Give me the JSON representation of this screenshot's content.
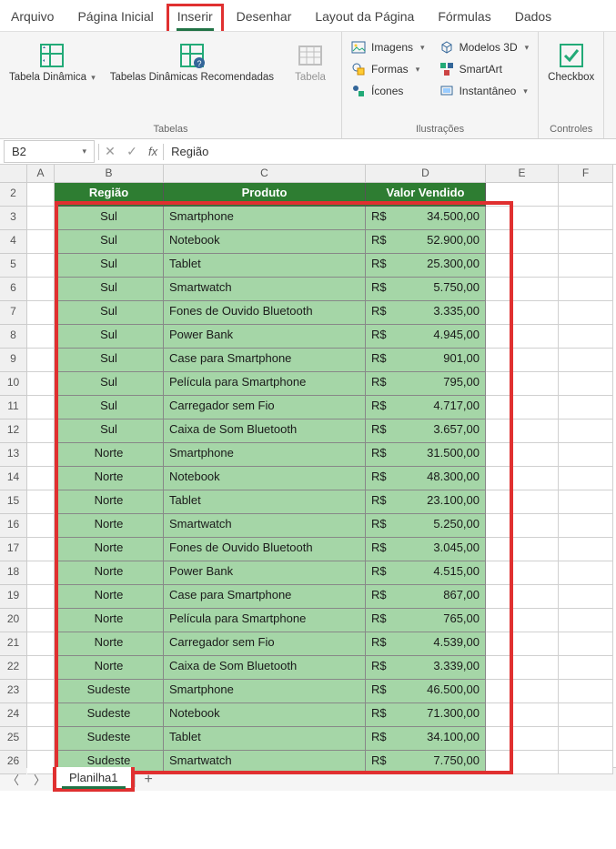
{
  "menubar": {
    "items": [
      "Arquivo",
      "Página Inicial",
      "Inserir",
      "Desenhar",
      "Layout da Página",
      "Fórmulas",
      "Dados"
    ],
    "activeIndex": 2
  },
  "ribbon": {
    "groups": {
      "tabelas": {
        "label": "Tabelas",
        "pivotTable": "Tabela\nDinâmica",
        "recommendedPivot": "Tabelas Dinâmicas\nRecomendadas",
        "table": "Tabela"
      },
      "ilustracoes": {
        "label": "Ilustrações",
        "images": "Imagens",
        "shapes": "Formas",
        "icons": "Ícones",
        "models3d": "Modelos 3D",
        "smartart": "SmartArt",
        "screenshot": "Instantâneo"
      },
      "controles": {
        "label": "Controles",
        "checkbox": "Checkbox"
      }
    }
  },
  "formulaBar": {
    "nameBox": "B2",
    "formula": "Região"
  },
  "columns": [
    "A",
    "B",
    "C",
    "D",
    "E",
    "F"
  ],
  "rowStart": 2,
  "rowCount": 25,
  "tableHeaders": {
    "regiao": "Região",
    "produto": "Produto",
    "valor": "Valor Vendido"
  },
  "tableData": [
    {
      "regiao": "Sul",
      "produto": "Smartphone",
      "cur": "R$",
      "valor": "34.500,00"
    },
    {
      "regiao": "Sul",
      "produto": "Notebook",
      "cur": "R$",
      "valor": "52.900,00"
    },
    {
      "regiao": "Sul",
      "produto": "Tablet",
      "cur": "R$",
      "valor": "25.300,00"
    },
    {
      "regiao": "Sul",
      "produto": "Smartwatch",
      "cur": "R$",
      "valor": "5.750,00"
    },
    {
      "regiao": "Sul",
      "produto": "Fones de Ouvido Bluetooth",
      "cur": "R$",
      "valor": "3.335,00"
    },
    {
      "regiao": "Sul",
      "produto": "Power Bank",
      "cur": "R$",
      "valor": "4.945,00"
    },
    {
      "regiao": "Sul",
      "produto": "Case para Smartphone",
      "cur": "R$",
      "valor": "901,00"
    },
    {
      "regiao": "Sul",
      "produto": "Película para Smartphone",
      "cur": "R$",
      "valor": "795,00"
    },
    {
      "regiao": "Sul",
      "produto": "Carregador sem Fio",
      "cur": "R$",
      "valor": "4.717,00"
    },
    {
      "regiao": "Sul",
      "produto": "Caixa de Som Bluetooth",
      "cur": "R$",
      "valor": "3.657,00"
    },
    {
      "regiao": "Norte",
      "produto": "Smartphone",
      "cur": "R$",
      "valor": "31.500,00"
    },
    {
      "regiao": "Norte",
      "produto": "Notebook",
      "cur": "R$",
      "valor": "48.300,00"
    },
    {
      "regiao": "Norte",
      "produto": "Tablet",
      "cur": "R$",
      "valor": "23.100,00"
    },
    {
      "regiao": "Norte",
      "produto": "Smartwatch",
      "cur": "R$",
      "valor": "5.250,00"
    },
    {
      "regiao": "Norte",
      "produto": "Fones de Ouvido Bluetooth",
      "cur": "R$",
      "valor": "3.045,00"
    },
    {
      "regiao": "Norte",
      "produto": "Power Bank",
      "cur": "R$",
      "valor": "4.515,00"
    },
    {
      "regiao": "Norte",
      "produto": "Case para Smartphone",
      "cur": "R$",
      "valor": "867,00"
    },
    {
      "regiao": "Norte",
      "produto": "Película para Smartphone",
      "cur": "R$",
      "valor": "765,00"
    },
    {
      "regiao": "Norte",
      "produto": "Carregador sem Fio",
      "cur": "R$",
      "valor": "4.539,00"
    },
    {
      "regiao": "Norte",
      "produto": "Caixa de Som Bluetooth",
      "cur": "R$",
      "valor": "3.339,00"
    },
    {
      "regiao": "Sudeste",
      "produto": "Smartphone",
      "cur": "R$",
      "valor": "46.500,00"
    },
    {
      "regiao": "Sudeste",
      "produto": "Notebook",
      "cur": "R$",
      "valor": "71.300,00"
    },
    {
      "regiao": "Sudeste",
      "produto": "Tablet",
      "cur": "R$",
      "valor": "34.100,00"
    },
    {
      "regiao": "Sudeste",
      "produto": "Smartwatch",
      "cur": "R$",
      "valor": "7.750,00"
    }
  ],
  "sheetTabs": {
    "active": "Planilha1"
  }
}
